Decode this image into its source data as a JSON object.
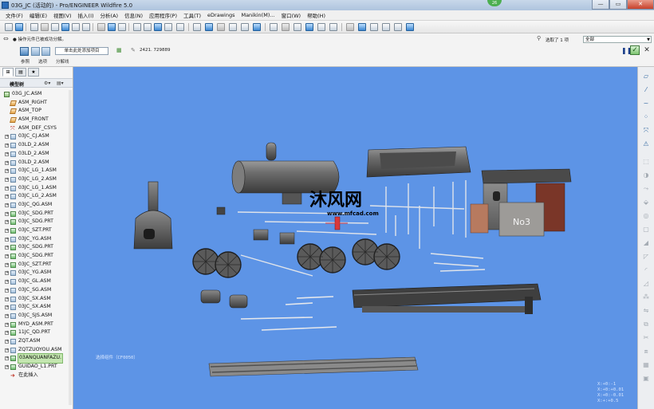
{
  "window": {
    "title": "03G_JC (活动的) - Pro/ENGINEER Wildfire 5.0",
    "notification_count": "26",
    "controls": [
      "—",
      "▭",
      "✕"
    ]
  },
  "menubar": {
    "items": [
      "文件(F)",
      "编辑(E)",
      "视图(V)",
      "插入(I)",
      "分析(A)",
      "信息(N)",
      "应用程序(P)",
      "工具(T)",
      "eDrawings",
      "Manikin(M)...",
      "窗口(W)",
      "帮助(H)"
    ]
  },
  "dashboard": {
    "message": "● 操作元件已被成功分解。",
    "selection_status": "选取了 1 项",
    "filter_value": "全部",
    "reference_button": "单击此处添加项目",
    "coordinate_value": "2421. 729889",
    "tabs": [
      "参照",
      "选项",
      "分解线"
    ]
  },
  "sidebar": {
    "header_label": "模型树",
    "tree": [
      {
        "label": "03G_JC.ASM",
        "icon": "root",
        "indent": 0
      },
      {
        "label": "ASM_RIGHT",
        "icon": "plane",
        "indent": 1
      },
      {
        "label": "ASM_TOP",
        "icon": "plane",
        "indent": 1
      },
      {
        "label": "ASM_FRONT",
        "icon": "plane",
        "indent": 1
      },
      {
        "label": "ASM_DEF_CSYS",
        "icon": "csys",
        "indent": 1
      },
      {
        "label": "03JC_CJ.ASM",
        "icon": "asm",
        "indent": 1,
        "expandable": true
      },
      {
        "label": "03LD_2.ASM",
        "icon": "asm",
        "indent": 1,
        "expandable": true
      },
      {
        "label": "03LD_2.ASM",
        "icon": "asm",
        "indent": 1,
        "expandable": true
      },
      {
        "label": "03LD_2.ASM",
        "icon": "asm",
        "indent": 1,
        "expandable": true
      },
      {
        "label": "03JC_LG_1.ASM",
        "icon": "asm",
        "indent": 1,
        "expandable": true
      },
      {
        "label": "03JC_LG_2.ASM",
        "icon": "asm",
        "indent": 1,
        "expandable": true
      },
      {
        "label": "03JC_LG_1.ASM",
        "icon": "asm",
        "indent": 1,
        "expandable": true
      },
      {
        "label": "03JC_LG_2.ASM",
        "icon": "asm",
        "indent": 1,
        "expandable": true
      },
      {
        "label": "03JC_QG.ASM",
        "icon": "asm",
        "indent": 1,
        "expandable": true
      },
      {
        "label": "03JC_SDG.PRT",
        "icon": "part",
        "indent": 1,
        "expandable": true
      },
      {
        "label": "03JC_SDG.PRT",
        "icon": "part",
        "indent": 1,
        "expandable": true
      },
      {
        "label": "03JC_SZT.PRT",
        "icon": "part",
        "indent": 1,
        "expandable": true
      },
      {
        "label": "03JC_YG.ASM",
        "icon": "asm",
        "indent": 1,
        "expandable": true
      },
      {
        "label": "03JC_SDG.PRT",
        "icon": "part",
        "indent": 1,
        "expandable": true
      },
      {
        "label": "03JC_SDG.PRT",
        "icon": "part",
        "indent": 1,
        "expandable": true
      },
      {
        "label": "03JC_SZT.PRT",
        "icon": "part",
        "indent": 1,
        "expandable": true
      },
      {
        "label": "03JC_YG.ASM",
        "icon": "asm",
        "indent": 1,
        "expandable": true
      },
      {
        "label": "03JC_GL.ASM",
        "icon": "asm",
        "indent": 1,
        "expandable": true
      },
      {
        "label": "03JC_SG.ASM",
        "icon": "asm",
        "indent": 1,
        "expandable": true
      },
      {
        "label": "03JC_SX.ASM",
        "icon": "asm",
        "indent": 1,
        "expandable": true
      },
      {
        "label": "03JC_SX.ASM",
        "icon": "asm",
        "indent": 1,
        "expandable": true
      },
      {
        "label": "03JC_SJS.ASM",
        "icon": "asm",
        "indent": 1,
        "expandable": true
      },
      {
        "label": "MYD_ASM.PRT",
        "icon": "part",
        "indent": 1,
        "expandable": true
      },
      {
        "label": "11JC_QD.PRT",
        "icon": "part",
        "indent": 1,
        "expandable": true
      },
      {
        "label": "ZQT.ASM",
        "icon": "asm",
        "indent": 1,
        "expandable": true
      },
      {
        "label": "ZQTZUOYOU.ASM",
        "icon": "asm",
        "indent": 1,
        "expandable": true
      },
      {
        "label": "03ANQUANFAZU.",
        "icon": "part",
        "indent": 1,
        "expandable": true,
        "selected": true
      },
      {
        "label": "GUIDAO_L1.PRT",
        "icon": "part",
        "indent": 1,
        "expandable": true
      },
      {
        "label": "在此插入",
        "icon": "insert",
        "indent": 1
      }
    ]
  },
  "graphics": {
    "background_color": "#5d94e6",
    "plate_text": "No3",
    "watermark_brand": "沐风网",
    "watermark_url": "www.mfcad.com",
    "status_label": "选择组件（CF0050）",
    "hud_lines": [
      "X:+0:-1",
      "X:+0:+0.01",
      "X:+0:-0.01",
      "X:+:+0.5"
    ]
  },
  "colors": {
    "accent": "#2a6bb8",
    "viewport": "#5d94e6",
    "selection": "#c4e6b0"
  }
}
